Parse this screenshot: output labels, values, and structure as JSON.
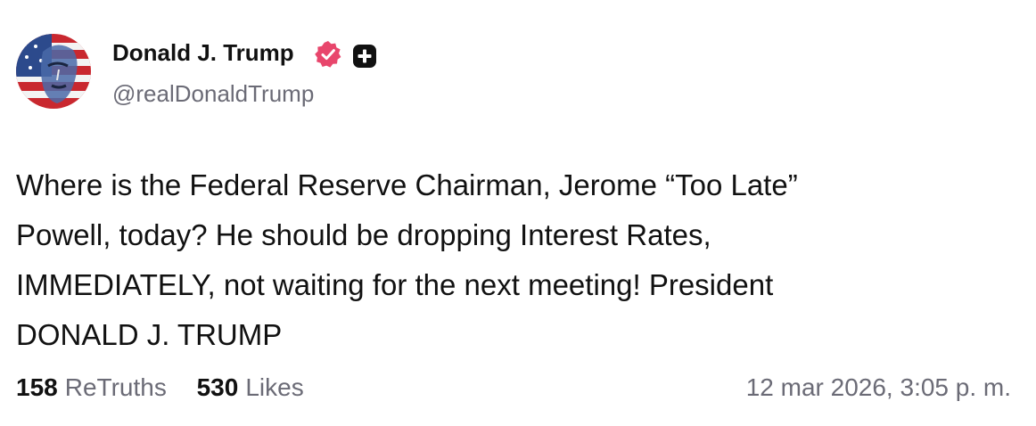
{
  "author": {
    "name": "Donald J. Trump",
    "handle": "@realDonaldTrump",
    "verified_badge_color": "#e8466c",
    "plus_badge_color": "#111111"
  },
  "post": {
    "lines": [
      "Where is the Federal Reserve Chairman, Jerome “Too Late”",
      "Powell, today? He should be dropping Interest Rates,",
      "IMMEDIATELY, not waiting for the next meeting! President",
      "DONALD J. TRUMP"
    ],
    "retruths_count": "158",
    "retruths_label": "ReTruths",
    "likes_count": "530",
    "likes_label": "Likes",
    "timestamp": "12 mar 2026, 3:05 p. m."
  },
  "icons": {
    "verified": "verified-badge-icon",
    "plus": "plus-badge-icon"
  }
}
